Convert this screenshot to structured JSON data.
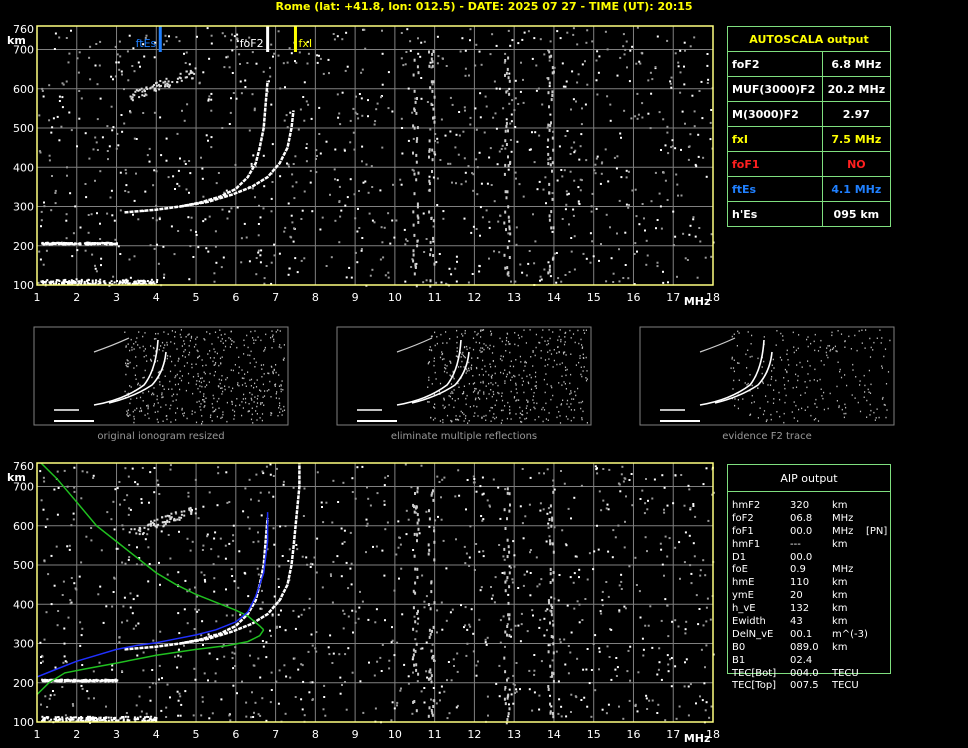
{
  "header": {
    "title": "Rome (lat: +41.8, lon: 012.5) - DATE: 2025 07 27 - TIME (UT): 20:15"
  },
  "colors": {
    "axis": "#ffff80",
    "grid": "#808080",
    "panel_border": "#7fdf7f",
    "fof2": "#ffffff",
    "fxl": "#ffff00",
    "fof1": "#ff2020",
    "ftes": "#2080ff",
    "profile_green": "#20c020",
    "profile_blue": "#2030ff"
  },
  "autoscala": {
    "title": "AUTOSCALA output",
    "rows": [
      {
        "label": "foF2",
        "value": "6.8 MHz",
        "color": "#ffffff"
      },
      {
        "label": "MUF(3000)F2",
        "value": "20.2 MHz",
        "color": "#ffffff"
      },
      {
        "label": "M(3000)F2",
        "value": "2.97",
        "color": "#ffffff"
      },
      {
        "label": "fxI",
        "value": "7.5 MHz",
        "color": "#ffff00"
      },
      {
        "label": "foF1",
        "value": "NO",
        "color": "#ff2020"
      },
      {
        "label": "ftEs",
        "value": "4.1 MHz",
        "color": "#2080ff"
      },
      {
        "label": "h'Es",
        "value": "095      km",
        "color": "#ffffff"
      }
    ]
  },
  "aip": {
    "title": "AIP output",
    "rows": [
      {
        "label": "hmF2",
        "value": "320",
        "unit": "km",
        "extra": ""
      },
      {
        "label": "foF2",
        "value": "06.8",
        "unit": "MHz",
        "extra": ""
      },
      {
        "label": "foF1",
        "value": "00.0",
        "unit": "MHz",
        "extra": "[PN]"
      },
      {
        "label": "hmF1",
        "value": "---",
        "unit": "km",
        "extra": ""
      },
      {
        "label": "D1",
        "value": "00.0",
        "unit": "",
        "extra": ""
      },
      {
        "label": "foE",
        "value": "0.9",
        "unit": "MHz",
        "extra": ""
      },
      {
        "label": "hmE",
        "value": "110",
        "unit": "km",
        "extra": ""
      },
      {
        "label": "ymE",
        "value": "20",
        "unit": "km",
        "extra": ""
      },
      {
        "label": "h_vE",
        "value": "132",
        "unit": "km",
        "extra": ""
      },
      {
        "label": "Ewidth",
        "value": "43",
        "unit": "km",
        "extra": ""
      },
      {
        "label": "DelN_vE",
        "value": "00.1",
        "unit": "m^(-3)",
        "extra": ""
      },
      {
        "label": "B0",
        "value": "089.0",
        "unit": "km",
        "extra": ""
      },
      {
        "label": "B1",
        "value": "02.4",
        "unit": "",
        "extra": ""
      },
      {
        "label": "TEC[Bot]",
        "value": "004.0",
        "unit": "TECU",
        "extra": ""
      },
      {
        "label": "TEC[Top]",
        "value": "007.5",
        "unit": "TECU",
        "extra": ""
      }
    ]
  },
  "thumbnails": [
    {
      "label": "original ionogram resized"
    },
    {
      "label": "eliminate multiple reflections"
    },
    {
      "label": "evidence F2 trace"
    }
  ],
  "chart_data": [
    {
      "type": "scatter",
      "name": "top-ionogram",
      "xlabel": "MHz",
      "ylabel": "km",
      "xlim": [
        1,
        18
      ],
      "ylim": [
        100,
        760
      ],
      "x_ticks": [
        1,
        2,
        3,
        4,
        5,
        6,
        7,
        8,
        9,
        10,
        11,
        12,
        13,
        14,
        15,
        16,
        17,
        18
      ],
      "y_ticks": [
        100,
        200,
        300,
        400,
        500,
        600,
        700
      ],
      "y_top_label": "760",
      "grid": true,
      "markers": [
        {
          "label": "ftEs",
          "x": 4.1,
          "color": "#2080ff"
        },
        {
          "label": "foF2",
          "x": 6.8,
          "color": "#ffffff"
        },
        {
          "label": "fxI",
          "x": 7.5,
          "color": "#ffff00"
        }
      ],
      "traces": [
        {
          "name": "o-trace",
          "points": [
            [
              3.2,
              285
            ],
            [
              4.0,
              292
            ],
            [
              4.6,
              300
            ],
            [
              5.1,
              310
            ],
            [
              5.6,
              325
            ],
            [
              6.0,
              345
            ],
            [
              6.3,
              375
            ],
            [
              6.5,
              410
            ],
            [
              6.6,
              450
            ],
            [
              6.7,
              500
            ],
            [
              6.75,
              560
            ],
            [
              6.8,
              620
            ]
          ]
        },
        {
          "name": "x-trace",
          "points": [
            [
              4.6,
              300
            ],
            [
              5.3,
              312
            ],
            [
              5.9,
              330
            ],
            [
              6.4,
              350
            ],
            [
              6.8,
              375
            ],
            [
              7.1,
              410
            ],
            [
              7.3,
              450
            ],
            [
              7.4,
              500
            ],
            [
              7.45,
              545
            ]
          ]
        },
        {
          "name": "multiple",
          "points": [
            [
              3.3,
              580
            ],
            [
              3.8,
              600
            ],
            [
              4.2,
              615
            ],
            [
              4.6,
              630
            ],
            [
              5.0,
              645
            ]
          ]
        },
        {
          "name": "Es",
          "points": [
            [
              1.1,
              208
            ],
            [
              2.0,
              205
            ],
            [
              2.8,
              207
            ],
            [
              3.0,
              206
            ]
          ]
        },
        {
          "name": "E-base",
          "points": [
            [
              1.1,
              110
            ],
            [
              2.0,
              108
            ],
            [
              3.0,
              110
            ],
            [
              4.0,
              109
            ]
          ]
        }
      ]
    },
    {
      "type": "scatter",
      "name": "bottom-ionogram",
      "xlabel": "MHz",
      "ylabel": "km",
      "xlim": [
        1,
        18
      ],
      "ylim": [
        100,
        760
      ],
      "x_ticks": [
        1,
        2,
        3,
        4,
        5,
        6,
        7,
        8,
        9,
        10,
        11,
        12,
        13,
        14,
        15,
        16,
        17,
        18
      ],
      "y_ticks": [
        100,
        200,
        300,
        400,
        500,
        600,
        700
      ],
      "y_top_label": "760",
      "grid": true,
      "profiles": [
        {
          "name": "green-upper",
          "color": "#20c020",
          "points": [
            [
              1.1,
              760
            ],
            [
              1.5,
              720
            ],
            [
              2.0,
              660
            ],
            [
              2.5,
              600
            ],
            [
              3.0,
              560
            ],
            [
              3.5,
              520
            ],
            [
              4.0,
              480
            ],
            [
              4.5,
              450
            ],
            [
              5.0,
              425
            ],
            [
              5.5,
              405
            ],
            [
              6.0,
              385
            ],
            [
              6.3,
              370
            ],
            [
              6.6,
              345
            ],
            [
              6.7,
              335
            ]
          ]
        },
        {
          "name": "green-lower",
          "color": "#20c020",
          "points": [
            [
              6.7,
              335
            ],
            [
              6.6,
              320
            ],
            [
              6.3,
              305
            ],
            [
              5.8,
              295
            ],
            [
              5.0,
              285
            ],
            [
              4.0,
              270
            ],
            [
              3.0,
              250
            ],
            [
              2.2,
              235
            ],
            [
              1.7,
              225
            ],
            [
              1.3,
              200
            ],
            [
              1.0,
              170
            ]
          ]
        },
        {
          "name": "blue-profile",
          "color": "#2030ff",
          "points": [
            [
              1.0,
              215
            ],
            [
              1.5,
              235
            ],
            [
              2.0,
              255
            ],
            [
              2.5,
              270
            ],
            [
              3.0,
              285
            ],
            [
              3.5,
              295
            ],
            [
              4.0,
              302
            ],
            [
              4.5,
              312
            ],
            [
              5.0,
              322
            ],
            [
              5.5,
              335
            ],
            [
              6.0,
              355
            ],
            [
              6.3,
              380
            ],
            [
              6.5,
              420
            ],
            [
              6.7,
              480
            ],
            [
              6.8,
              560
            ],
            [
              6.8,
              635
            ]
          ]
        }
      ],
      "traces": [
        {
          "name": "o-trace",
          "points": [
            [
              3.2,
              285
            ],
            [
              4.0,
              292
            ],
            [
              4.6,
              300
            ],
            [
              5.1,
              310
            ],
            [
              5.6,
              325
            ],
            [
              6.0,
              345
            ],
            [
              6.3,
              375
            ],
            [
              6.5,
              410
            ],
            [
              6.6,
              450
            ],
            [
              6.7,
              500
            ],
            [
              6.75,
              560
            ],
            [
              6.8,
              620
            ]
          ]
        },
        {
          "name": "x-trace",
          "points": [
            [
              4.6,
              300
            ],
            [
              5.3,
              312
            ],
            [
              5.9,
              330
            ],
            [
              6.4,
              350
            ],
            [
              6.8,
              375
            ],
            [
              7.1,
              410
            ],
            [
              7.3,
              450
            ],
            [
              7.4,
              500
            ],
            [
              7.45,
              545
            ],
            [
              7.6,
              700
            ],
            [
              7.6,
              760
            ]
          ]
        },
        {
          "name": "multiple",
          "points": [
            [
              3.3,
              580
            ],
            [
              3.8,
              600
            ],
            [
              4.2,
              615
            ],
            [
              4.6,
              630
            ],
            [
              5.0,
              645
            ]
          ]
        },
        {
          "name": "Es",
          "points": [
            [
              1.1,
              208
            ],
            [
              2.0,
              205
            ],
            [
              2.8,
              207
            ],
            [
              3.0,
              206
            ]
          ]
        },
        {
          "name": "E-base",
          "points": [
            [
              1.1,
              110
            ],
            [
              2.0,
              108
            ],
            [
              3.0,
              110
            ],
            [
              4.0,
              109
            ]
          ]
        }
      ]
    }
  ]
}
